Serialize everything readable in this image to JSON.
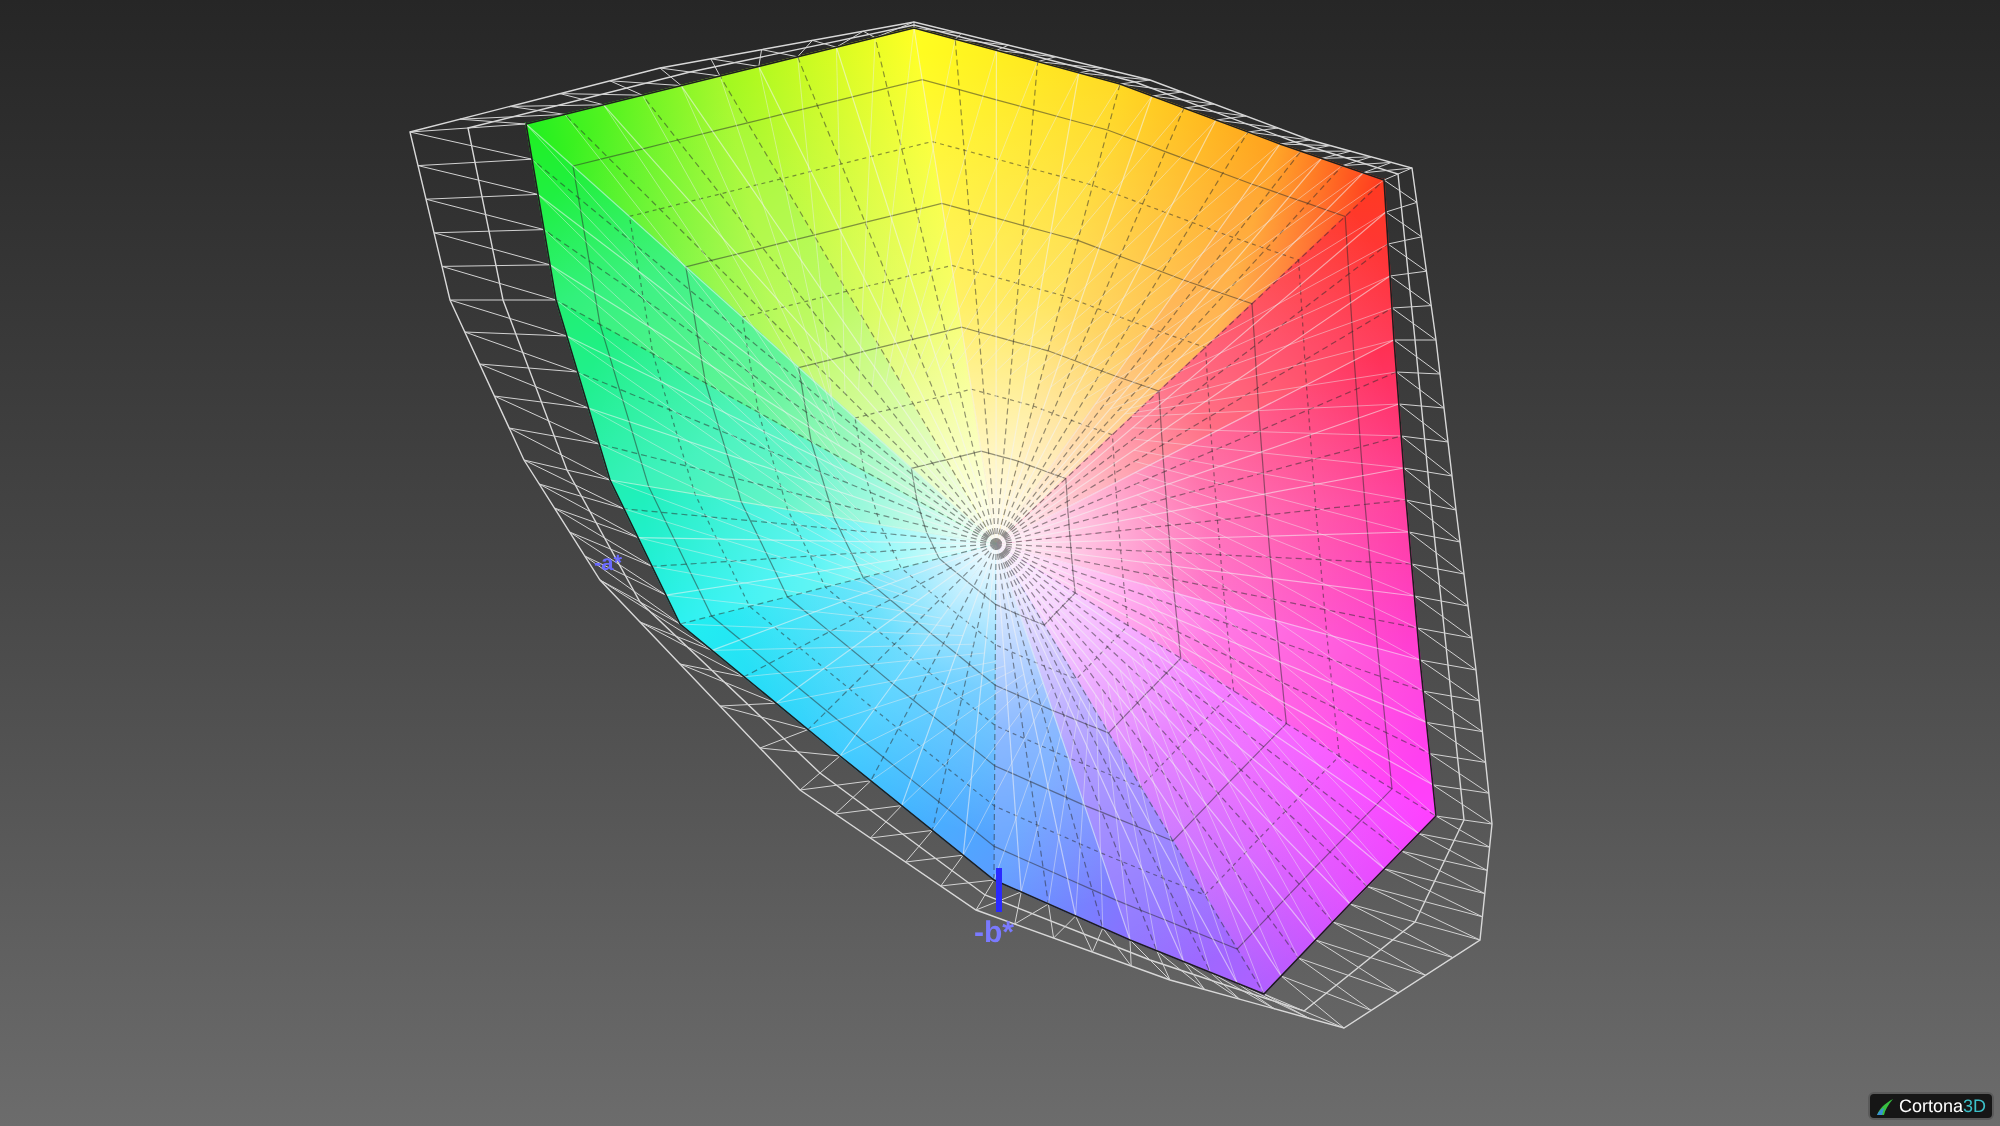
{
  "viewport": {
    "axes": [
      {
        "kind": "a",
        "label": "-a*"
      },
      {
        "kind": "b",
        "label": "-b*"
      }
    ]
  },
  "logo": {
    "text": "Cortona",
    "accent": "3D"
  }
}
